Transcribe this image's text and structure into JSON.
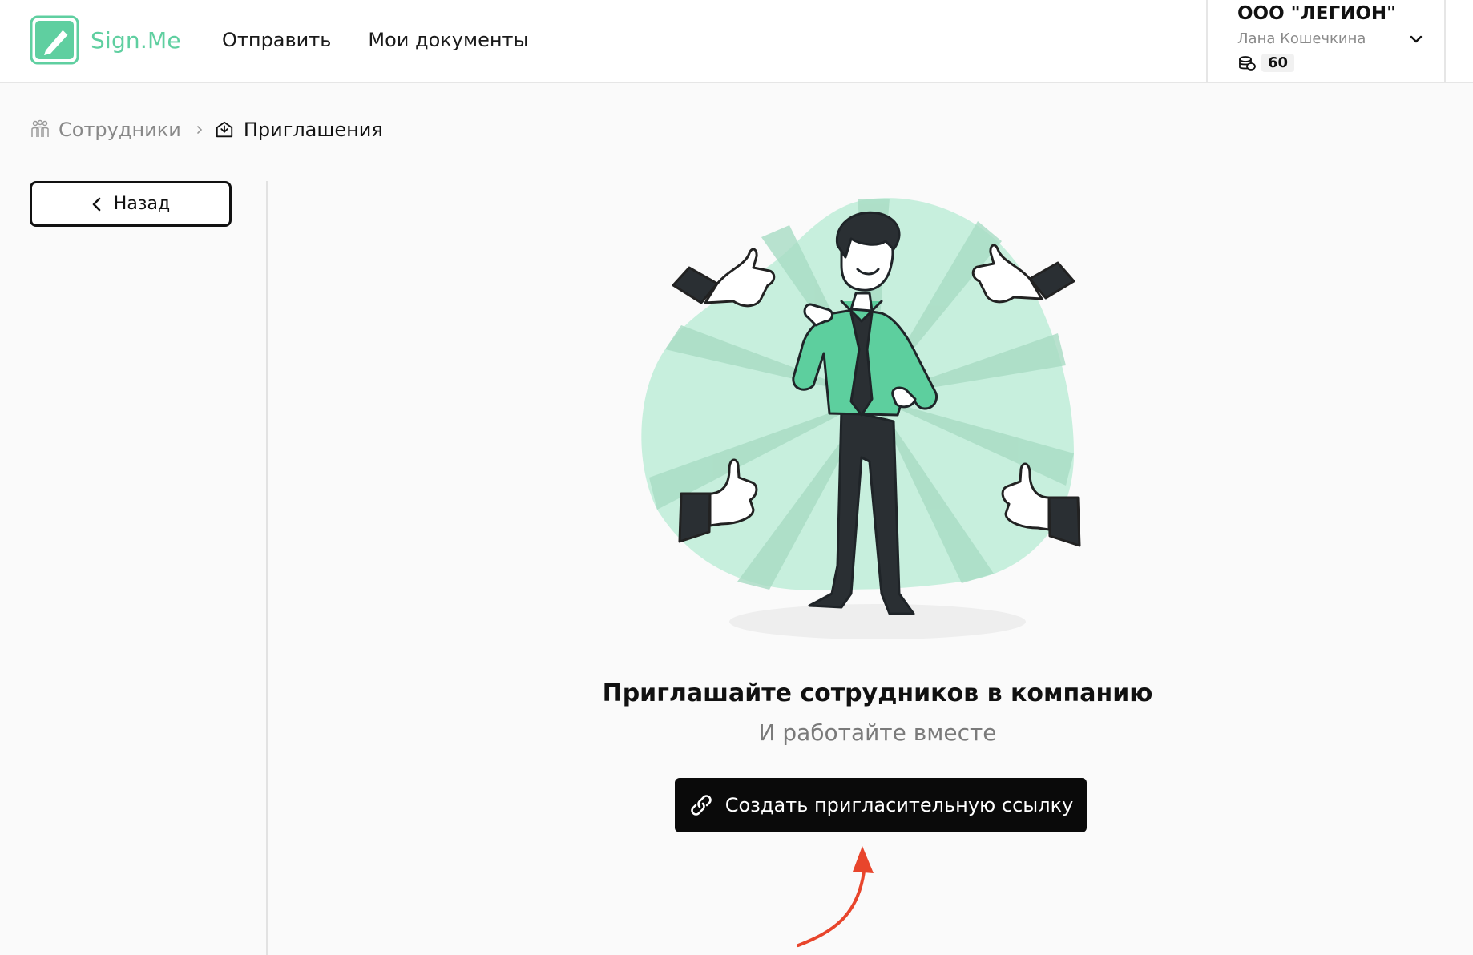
{
  "header": {
    "logo_text": "Sign.Me",
    "nav": [
      {
        "label": "Отправить"
      },
      {
        "label": "Мои документы"
      }
    ],
    "account": {
      "org_name": "ООО \"ЛЕГИОН\"",
      "user_name": "Лана Кошечкина",
      "coins": "60"
    }
  },
  "breadcrumb": {
    "parent": "Сотрудники",
    "current": "Приглашения"
  },
  "sidebar": {
    "back_label": "Назад"
  },
  "main": {
    "headline": "Приглашайте сотрудников в компанию",
    "subline": "И работайте вместе",
    "cta_label": "Создать пригласительную ссылку"
  },
  "colors": {
    "brand": "#5fcfa0",
    "accent_arrow": "#e8452c",
    "cta_bg": "#0a0a0a"
  },
  "icons": [
    "logo-icon",
    "chevron-down-icon",
    "coins-icon",
    "people-icon",
    "chevron-right-icon",
    "inbox-icon",
    "chevron-left-icon",
    "link-icon",
    "arrow-pointer-icon"
  ]
}
